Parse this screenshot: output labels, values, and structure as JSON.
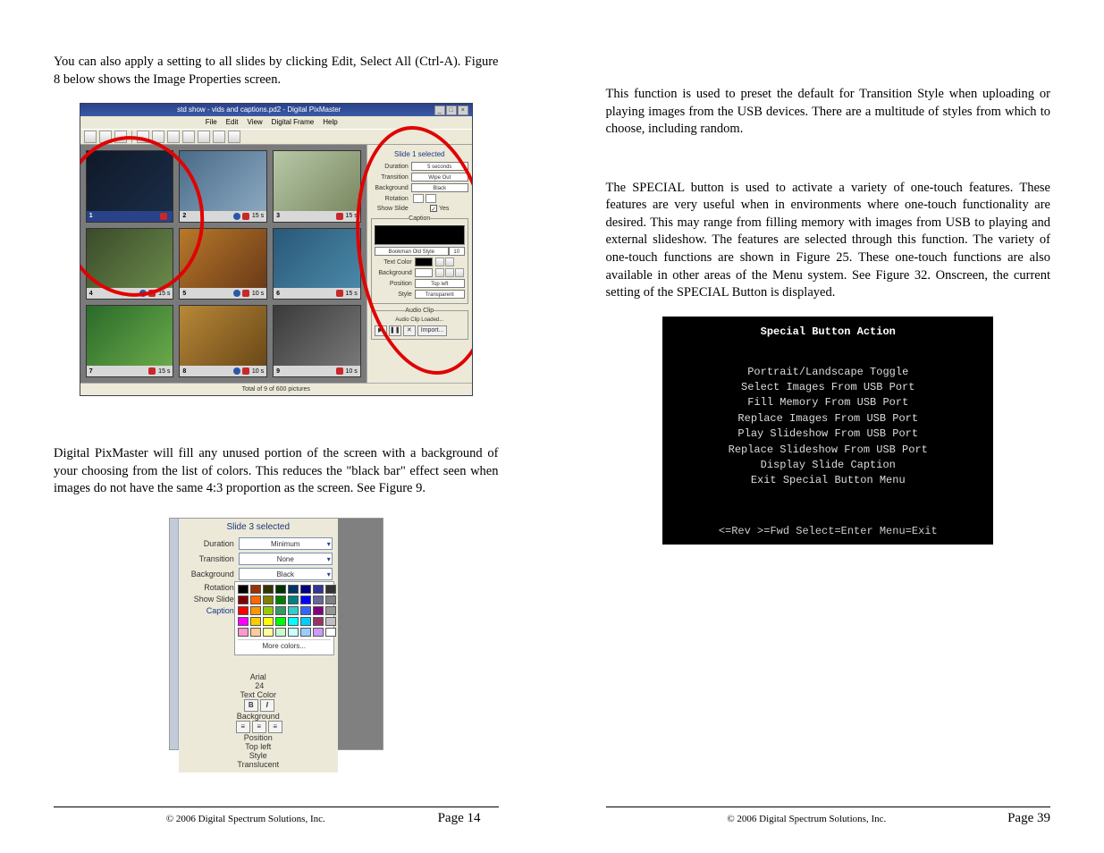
{
  "left": {
    "para1": "You can also apply a setting to all slides by clicking Edit, Select All (Ctrl-A). Figure 8 below shows the Image Properties screen.",
    "para2": "Digital PixMaster will fill any unused portion of the screen with a background of your choosing from the list of colors. This reduces the \"black bar\" effect seen when images do not have the same 4:3 proportion as the                            screen.  See Figure 9.",
    "footer_copy": "© 2006 Digital Spectrum Solutions, Inc.",
    "footer_page": "Page 14"
  },
  "fig8": {
    "window_title": "std show - vids and captions.pd2 - Digital PixMaster",
    "menus": [
      "File",
      "Edit",
      "View",
      "Digital Frame",
      "Help"
    ],
    "status": "Total of 9 of 600 pictures",
    "side_header": "Slide 1 selected",
    "fields": {
      "duration_label": "Duration",
      "duration_value": "5 seconds",
      "transition_label": "Transition",
      "transition_value": "Wipe Out",
      "background_label": "Background",
      "background_value": "Black",
      "rotation_label": "Rotation",
      "showslide_label": "Show Slide",
      "showslide_value": "Yes"
    },
    "caption": {
      "legend": "Caption",
      "font_value": "Bookman Old Style",
      "textcolor_label": "Text Color",
      "bg_label": "Background",
      "position_label": "Position",
      "position_value": "Top left",
      "style_label": "Style",
      "style_value": "Transparent"
    },
    "audio": {
      "legend": "Audio Clip",
      "text": "Audio Clip Loaded...",
      "import": "Import..."
    },
    "thumbs": [
      {
        "num": "1",
        "dur": "",
        "sel": true,
        "c1": "#101828",
        "c2": "#1a2d48"
      },
      {
        "num": "2",
        "dur": "15 s",
        "c1": "#4a6a88",
        "c2": "#8aa8c0"
      },
      {
        "num": "3",
        "dur": "15 s",
        "c1": "#b8c8a8",
        "c2": "#7a8860"
      },
      {
        "num": "4",
        "dur": "15 s",
        "c1": "#3a4a2a",
        "c2": "#6a8a4a"
      },
      {
        "num": "5",
        "dur": "10 s",
        "c1": "#b8782a",
        "c2": "#6a3a18"
      },
      {
        "num": "6",
        "dur": "15 s",
        "c1": "#2a5878",
        "c2": "#4a88a8"
      },
      {
        "num": "7",
        "dur": "15 s",
        "c1": "#2a6a2a",
        "c2": "#6aaa4a"
      },
      {
        "num": "8",
        "dur": "10 s",
        "c1": "#b88838",
        "c2": "#6a4818"
      },
      {
        "num": "9",
        "dur": "10 s",
        "c1": "#3a3a3a",
        "c2": "#787878"
      }
    ]
  },
  "fig9": {
    "header": "Slide 3 selected",
    "duration_label": "Duration",
    "duration_value": "Minimum",
    "transition_label": "Transition",
    "transition_value": "None",
    "background_label": "Background",
    "background_value": "Black",
    "rotation_label": "Rotation",
    "showslide_label": "Show Slide",
    "caption_label": "Caption",
    "more_colors": "More colors...",
    "font_value": "Arial",
    "size_value": "24",
    "textcolor_label": "Text Color",
    "bg_label": "Background",
    "position_label": "Position",
    "position_value": "Top left",
    "style_label": "Style",
    "style_value": "Translucent",
    "colors": [
      "#000000",
      "#993300",
      "#333300",
      "#003300",
      "#003366",
      "#000080",
      "#333399",
      "#333333",
      "#800000",
      "#ff6600",
      "#808000",
      "#008000",
      "#008080",
      "#0000ff",
      "#666699",
      "#808080",
      "#ff0000",
      "#ff9900",
      "#99cc00",
      "#339966",
      "#33cccc",
      "#3366ff",
      "#800080",
      "#969696",
      "#ff00ff",
      "#ffcc00",
      "#ffff00",
      "#00ff00",
      "#00ffff",
      "#00ccff",
      "#993366",
      "#c0c0c0",
      "#ff99cc",
      "#ffcc99",
      "#ffff99",
      "#ccffcc",
      "#ccffff",
      "#99ccff",
      "#cc99ff",
      "#ffffff"
    ]
  },
  "right": {
    "para1": "This function is used to preset the default for Transition Style when uploading or playing images from the USB devices. There are a multitude of styles from which to choose, including random.",
    "para2": "The SPECIAL button is used to activate a variety of one-touch features. These features are very useful when in environments where one-touch functionality are desired. This may range from filling memory with images from USB to playing and external slideshow. The features are selected through this function. The variety of one-touch functions are shown in Figure 25. These one-touch functions are also available in other areas of the Menu system. See Figure 32. Onscreen, the current setting of the SPECIAL Button is displayed.",
    "footer_copy": "© 2006 Digital Spectrum Solutions, Inc.",
    "footer_page": "Page 39"
  },
  "special": {
    "title": "Special Button Action",
    "items": [
      "Portrait/Landscape Toggle",
      "Select Images From USB Port",
      "Fill Memory From USB Port",
      "Replace Images From USB Port",
      "Play Slideshow From USB Port",
      "Replace Slideshow From USB Port",
      "Display Slide Caption",
      "Exit Special Button Menu"
    ],
    "hint": "<=Rev >=Fwd Select=Enter Menu=Exit"
  }
}
